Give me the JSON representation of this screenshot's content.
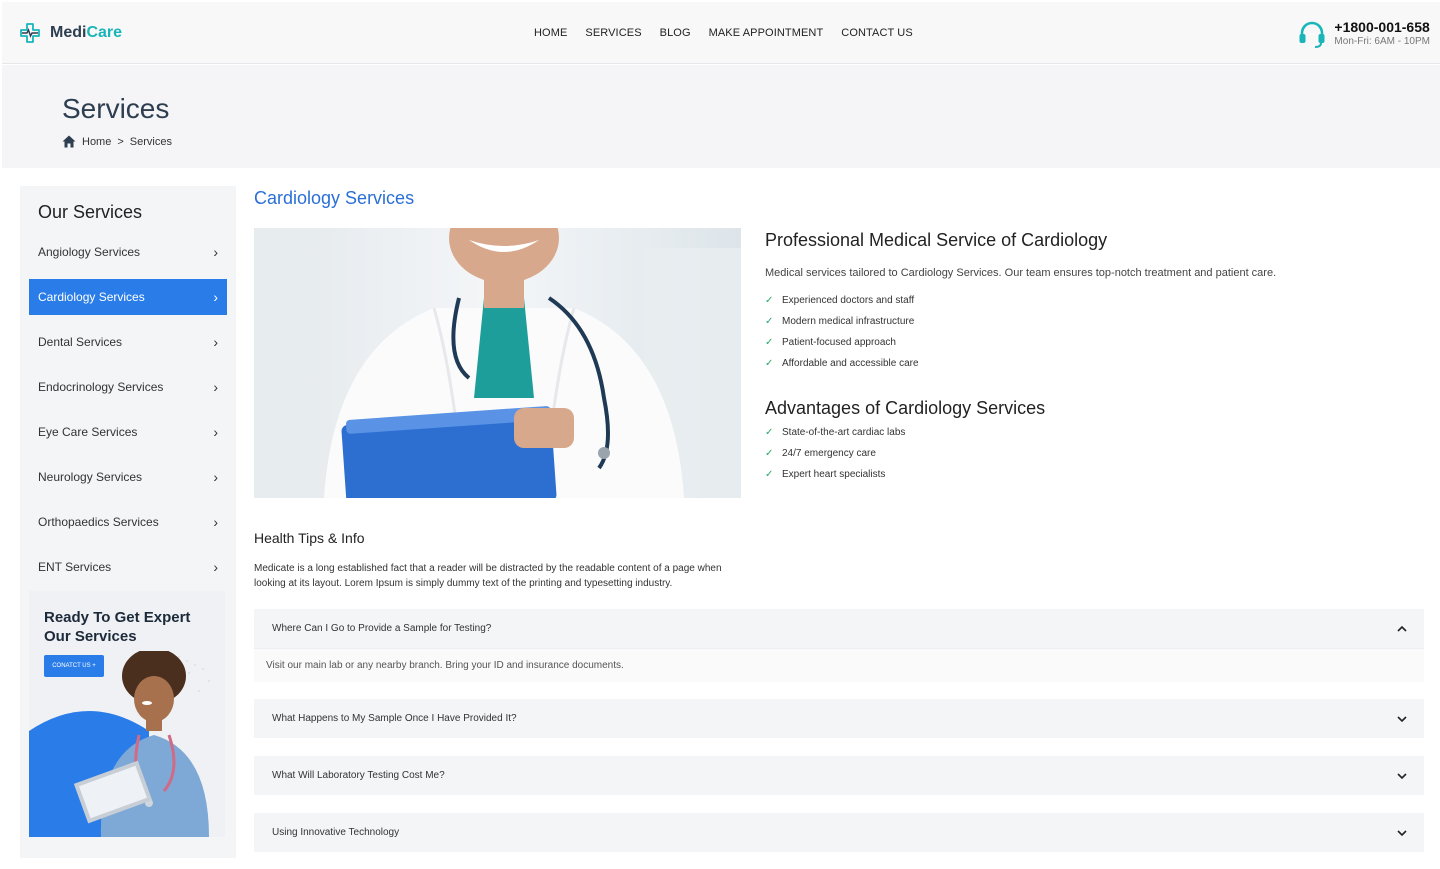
{
  "brand": {
    "name_part1": "Medi",
    "name_part2": "Care"
  },
  "nav": {
    "items": [
      "HOME",
      "SERVICES",
      "BLOG",
      "MAKE APPOINTMENT",
      "CONTACT US"
    ]
  },
  "contact": {
    "phone": "+1800-001-658",
    "hours": "Mon-Fri: 6AM - 10PM"
  },
  "page": {
    "title": "Services",
    "breadcrumb": {
      "home": "Home",
      "separator": ">",
      "current": "Services"
    }
  },
  "sidebar": {
    "title": "Our Services",
    "items": [
      {
        "label": "Angiology Services",
        "active": false
      },
      {
        "label": "Cardiology Services",
        "active": true
      },
      {
        "label": "Dental Services",
        "active": false
      },
      {
        "label": "Endocrinology Services",
        "active": false
      },
      {
        "label": "Eye Care Services",
        "active": false
      },
      {
        "label": "Neurology Services",
        "active": false
      },
      {
        "label": "Orthopaedics Services",
        "active": false
      },
      {
        "label": "ENT Services",
        "active": false
      }
    ],
    "promo": {
      "title": "Ready To Get Expert Our Services",
      "button": "CONATCT US +"
    }
  },
  "main": {
    "title": "Cardiology Services",
    "professional": {
      "heading": "Professional Medical Service of Cardiology",
      "description": "Medical services tailored to Cardiology Services. Our team ensures top-notch treatment and patient care.",
      "points": [
        "Experienced doctors and staff",
        "Modern medical infrastructure",
        "Patient-focused approach",
        "Affordable and accessible care"
      ]
    },
    "advantages": {
      "heading": "Advantages of Cardiology Services",
      "points": [
        "State-of-the-art cardiac labs",
        "24/7 emergency care",
        "Expert heart specialists"
      ]
    },
    "tips": {
      "heading": "Health Tips & Info",
      "body": "Medicate is a long established fact that a reader will be distracted by the readable content of a page when looking at its layout. Lorem Ipsum is simply dummy text of the printing and typesetting industry."
    },
    "faq": [
      {
        "question": "Where Can I Go to Provide a Sample for Testing?",
        "answer": "Visit our main lab or any nearby branch. Bring your ID and insurance documents.",
        "open": true
      },
      {
        "question": "What Happens to My Sample Once I Have Provided It?",
        "answer": "",
        "open": false
      },
      {
        "question": "What Will Laboratory Testing Cost Me?",
        "answer": "",
        "open": false
      },
      {
        "question": "Using Innovative Technology",
        "answer": "",
        "open": false
      }
    ]
  },
  "colors": {
    "accent": "#2a7de9",
    "brand_teal": "#19b5b9",
    "title_blue": "#2a6fd6",
    "check_green": "#2aa868"
  },
  "icons": {
    "logo": "medical-cross-icon",
    "phone": "headset-icon",
    "breadcrumb_home": "home-icon",
    "sidebar_chevron": "chevron-right-icon",
    "list_check": "check-icon",
    "faq_open": "chevron-up-icon",
    "faq_closed": "chevron-down-icon"
  }
}
